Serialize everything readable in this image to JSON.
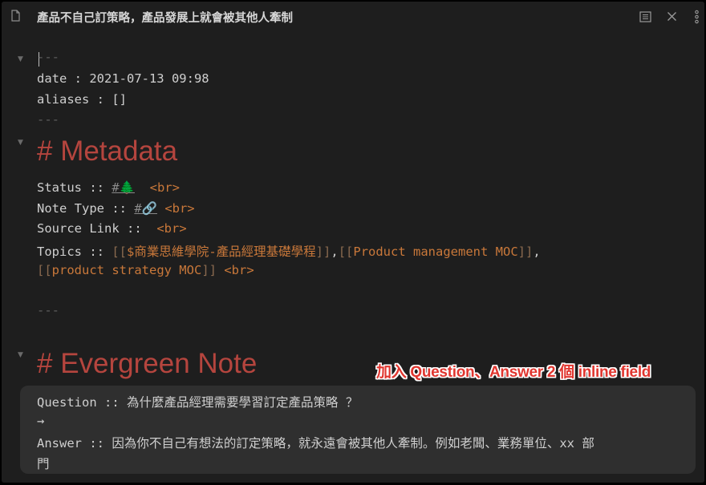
{
  "title": "產品不自己訂策略，產品發展上就會被其他人牽制",
  "toolbar": {
    "reading_icon": "reading-view-icon",
    "close_icon": "close-icon",
    "more_icon": "more-options-icon"
  },
  "frontmatter": {
    "open": "---",
    "date_line": "date : 2021-07-13 09:98",
    "aliases_line": "aliases : []",
    "close": "---"
  },
  "metadata": {
    "heading": "# Metadata",
    "status_label": "Status :: ",
    "status_tag": "#🌲",
    "br": "<br>",
    "note_type_label": "Note Type :: ",
    "note_type_tag": "#🔗",
    "source_link_label": "Source Link :: ",
    "topics_label": "Topics :: ",
    "open_brackets": "[[",
    "close_brackets": "]]",
    "comma": ",",
    "topic_1": "$商業思維學院-產品經理基礎學程",
    "topic_2": "Product management MOC",
    "topic_3": "product strategy MOC",
    "separator": "---"
  },
  "evergreen": {
    "heading": "# Evergreen Note",
    "question_label": "Question :: ",
    "question_text": "為什麼產品經理需要學習訂定產品策略 ？",
    "arrow": "→",
    "answer_label": "Answer :: ",
    "answer_text": "因為你不自己有想法的訂定策略，就永遠會被其他人牽制。例如老闆、業務單位、xx 部",
    "answer_text_2": "門"
  },
  "annotation": "加入 Question、Answer 2 個 inline field",
  "colors": {
    "heading": "#b5453e",
    "link": "#c9783a",
    "annotation": "#e0362f"
  }
}
